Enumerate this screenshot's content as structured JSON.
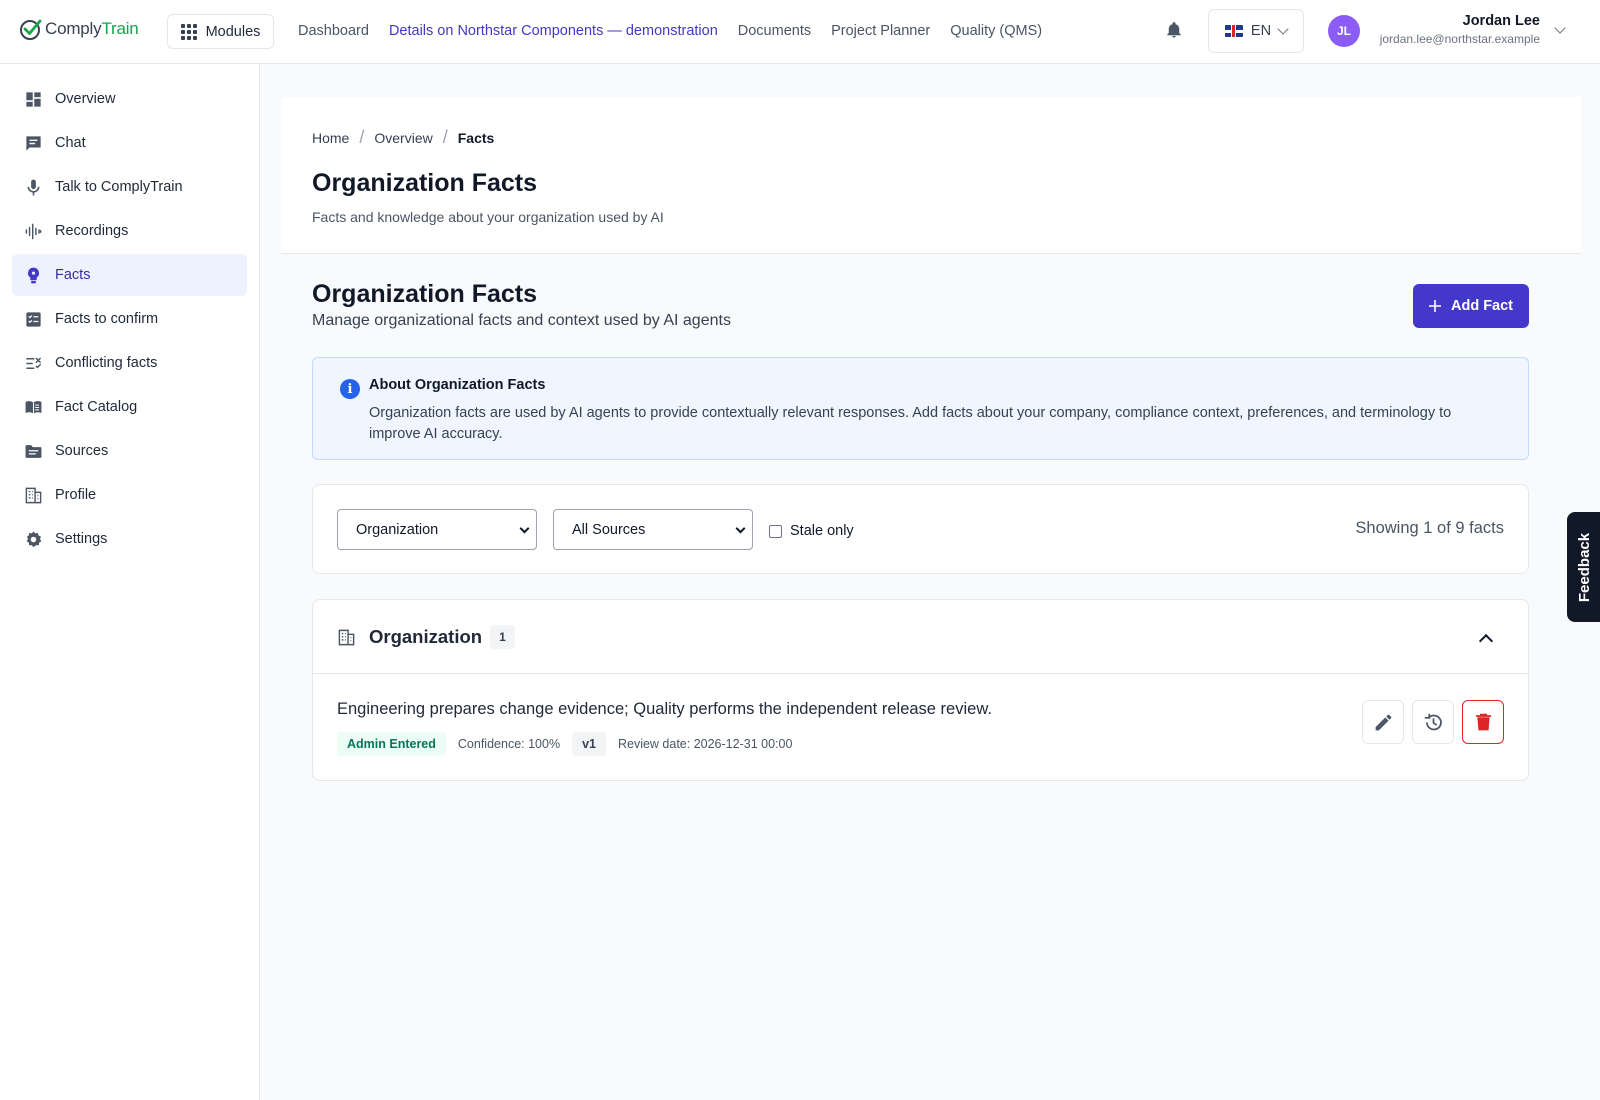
{
  "app": {
    "logo_prefix": "Comply",
    "logo_suffix": "Train",
    "modules_label": "Modules"
  },
  "topnav": [
    {
      "label": "Dashboard",
      "active": false
    },
    {
      "label": "Details on Northstar Components — demonstration",
      "active": true
    },
    {
      "label": "Documents",
      "active": false
    },
    {
      "label": "Project Planner",
      "active": false
    },
    {
      "label": "Quality (QMS)",
      "active": false
    }
  ],
  "language": {
    "code": "EN",
    "flag": "uk-flag-icon"
  },
  "user": {
    "initials": "JL",
    "name": "Jordan Lee",
    "email": "jordan.lee@northstar.example",
    "avatar_color": "#8b5cf6"
  },
  "sidebar": {
    "items": [
      {
        "label": "Overview",
        "icon": "dashboard-icon",
        "active": false
      },
      {
        "label": "Chat",
        "icon": "chat-icon",
        "active": false
      },
      {
        "label": "Talk to ComplyTrain",
        "icon": "microphone-icon",
        "active": false
      },
      {
        "label": "Recordings",
        "icon": "waveform-icon",
        "active": false
      },
      {
        "label": "Facts",
        "icon": "lightbulb-icon",
        "active": true
      },
      {
        "label": "Facts to confirm",
        "icon": "checklist-icon",
        "active": false
      },
      {
        "label": "Conflicting facts",
        "icon": "conflict-list-icon",
        "active": false
      },
      {
        "label": "Fact Catalog",
        "icon": "book-icon",
        "active": false
      },
      {
        "label": "Sources",
        "icon": "folder-icon",
        "active": false
      },
      {
        "label": "Profile",
        "icon": "building-icon",
        "active": false
      },
      {
        "label": "Settings",
        "icon": "gear-icon",
        "active": false
      }
    ]
  },
  "breadcrumb": [
    "Home",
    "Overview",
    "Facts"
  ],
  "page": {
    "title": "Organization Facts",
    "subtitle": "Facts and knowledge about your organization used by AI"
  },
  "section": {
    "title": "Organization Facts",
    "subtitle": "Manage organizational facts and context used by AI agents",
    "add_button": "Add Fact"
  },
  "info": {
    "title": "About Organization Facts",
    "text": "Organization facts are used by AI agents to provide contextually relevant responses. Add facts about your company, compliance context, preferences, and terminology to improve AI accuracy."
  },
  "filters": {
    "scope_selected": "Organization",
    "source_selected": "All Sources",
    "stale_label": "Stale only",
    "stale_checked": false,
    "showing_text": "Showing 1 of 9 facts"
  },
  "group": {
    "title": "Organization",
    "count": "1",
    "expanded": true,
    "facts": [
      {
        "text": "Engineering prepares change evidence; Quality performs the independent release review.",
        "source_tag": "Admin Entered",
        "confidence": "Confidence: 100%",
        "version": "v1",
        "review_date": "Review date: 2026-12-31 00:00"
      }
    ]
  },
  "feedback_label": "Feedback",
  "colors": {
    "primary": "#4338ca",
    "active_bg": "#eef2ff",
    "danger": "#dc2626",
    "success_text": "#047857",
    "info_bg": "#eff6ff"
  }
}
